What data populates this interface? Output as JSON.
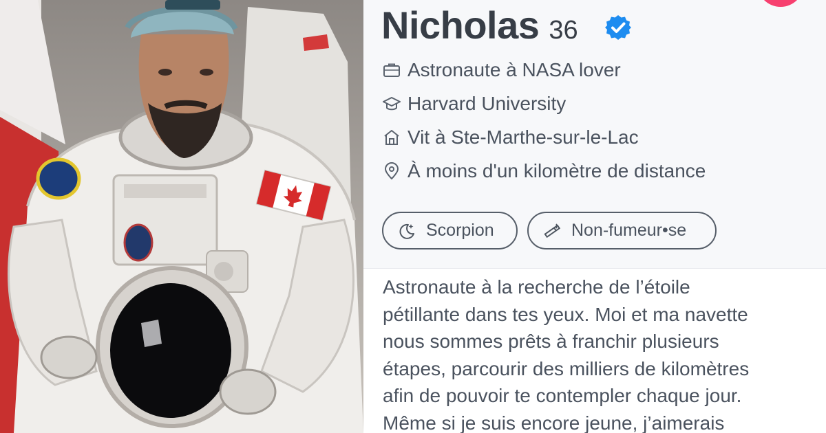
{
  "profile": {
    "name": "Nicholas",
    "age": "36",
    "info": [
      {
        "icon": "briefcase-icon",
        "text": "Astronaute à NASA lover"
      },
      {
        "icon": "graduation-cap-icon",
        "text": "Harvard University"
      },
      {
        "icon": "home-icon",
        "text": "Vit à Ste-Marthe-sur-le-Lac"
      },
      {
        "icon": "location-pin-icon",
        "text": "À moins d'un kilomètre de distance"
      }
    ],
    "chips": [
      {
        "icon": "moon-stars-icon",
        "text": "Scorpion"
      },
      {
        "icon": "cigarette-icon",
        "text": "Non-fumeur•se"
      }
    ],
    "bio_lines": [
      "Astronaute à la recherche de l’étoile",
      "pétillante dans tes yeux. Moi et ma navette",
      "nous sommes prêts à franchir plusieurs",
      "étapes, parcourir des milliers de kilomètres",
      "afin de pouvoir te contempler chaque jour.",
      "Même si je suis encore jeune, j’aimerais"
    ]
  },
  "colors": {
    "accent_pink": "#f7406f",
    "verified_blue": "#1d8cf0",
    "text": "#4a525e"
  }
}
